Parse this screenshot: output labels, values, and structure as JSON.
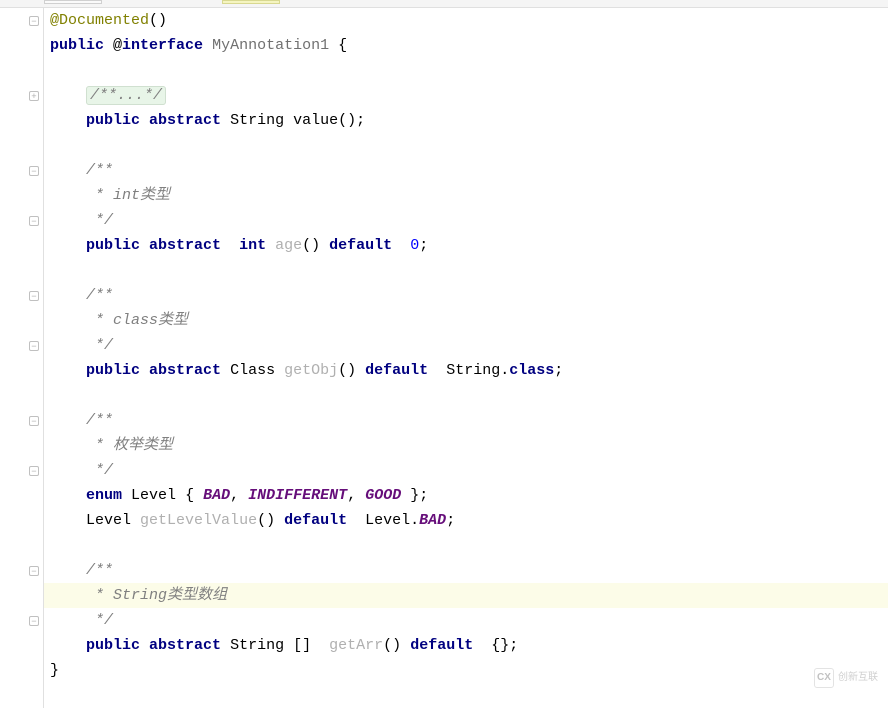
{
  "code": {
    "annotation": "@Documented",
    "annot_parens": "()",
    "decl": {
      "public": "public",
      "at_interface": "@",
      "interface_kw": "interface",
      "name": "MyAnnotation1",
      "brace": "{"
    },
    "folded_comment": "/**...*/",
    "m1": {
      "public": "public",
      "abstract": "abstract",
      "type": "String",
      "name": "value",
      "tail": "();"
    },
    "c1_open": "/**",
    "c1_body": " * int类型",
    "c1_close": " */",
    "m2": {
      "public": "public",
      "abstract": "abstract",
      "type": "int",
      "name": "age",
      "parens": "()",
      "default_kw": "default",
      "val": "0",
      "semi": ";"
    },
    "c2_open": "/**",
    "c2_body": " * class类型",
    "c2_close": " */",
    "m3": {
      "public": "public",
      "abstract": "abstract",
      "type": "Class",
      "name": "getObj",
      "parens": "()",
      "default_kw": "default",
      "val_type": "String",
      "dot": ".",
      "class_kw": "class",
      "semi": ";"
    },
    "c3_open": "/**",
    "c3_body": " * 枚举类型",
    "c3_close": " */",
    "enum_line": {
      "enum_kw": "enum",
      "name": "Level",
      "open": "{",
      "v1": "BAD",
      "c1": ",",
      "v2": "INDIFFERENT",
      "c2": ",",
      "v3": "GOOD",
      "close": "};"
    },
    "m4": {
      "type": "Level",
      "name": "getLevelValue",
      "parens": "()",
      "default_kw": "default",
      "val_type": "Level",
      "dot": ".",
      "val": "BAD",
      "semi": ";"
    },
    "c4_open": "/**",
    "c4_body": " * String类型数组",
    "c4_close": " */",
    "m5": {
      "public": "public",
      "abstract": "abstract",
      "type": "String",
      "brackets": "[]",
      "name": "getArr",
      "parens": "()",
      "default_kw": "default",
      "val": "{}",
      "semi": ";"
    },
    "close_brace": "}"
  },
  "watermark": "创新互联"
}
